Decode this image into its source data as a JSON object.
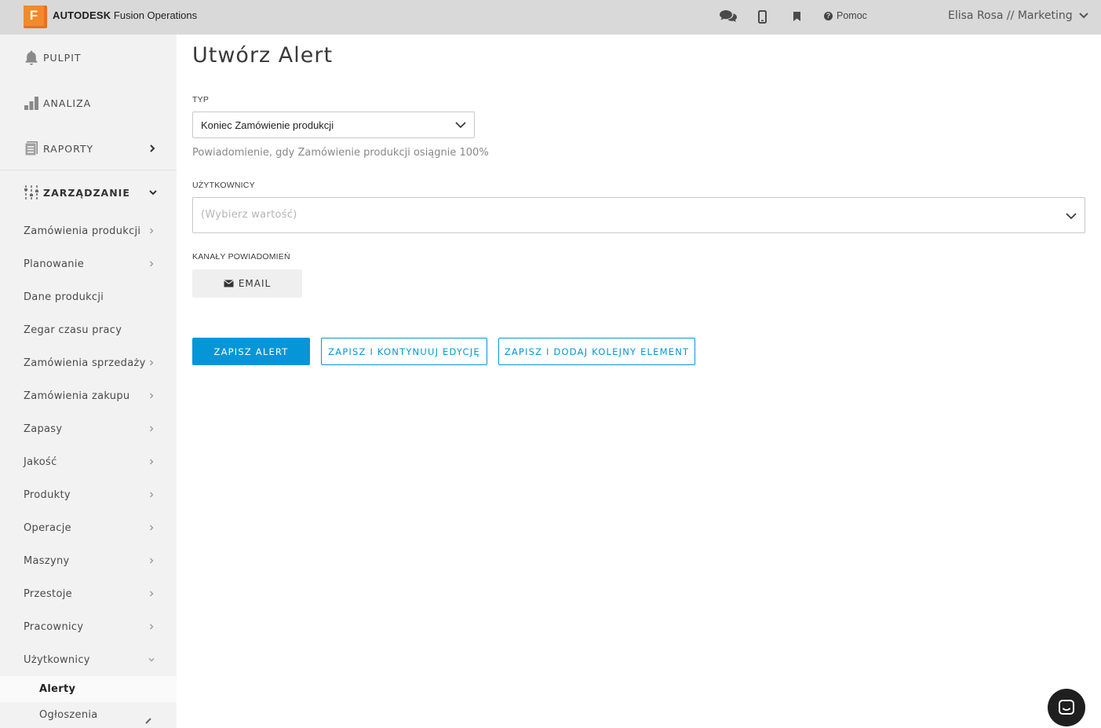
{
  "header": {
    "logo_letter": "F",
    "brand_bold": "AUTODESK",
    "brand_rest": " Fusion Operations",
    "icons": [
      "chat-icon",
      "mobile-icon",
      "bookmark-icon"
    ],
    "help_label": "Pomoc",
    "user_label": "Elisa Rosa // Marketing"
  },
  "sidebar": {
    "main": [
      {
        "label": "PULPIT",
        "icon": "bell-icon"
      },
      {
        "label": "ANALIZA",
        "icon": "bar-chart-icon"
      },
      {
        "label": "RAPORTY",
        "icon": "report-icon"
      },
      {
        "label": "ZARZĄDZANIE",
        "icon": "sliders-icon"
      }
    ],
    "items": [
      {
        "label": "Zamówienia produkcji"
      },
      {
        "label": "Planowanie"
      },
      {
        "label": "Dane produkcji"
      },
      {
        "label": "Zegar czasu pracy"
      },
      {
        "label": "Zamówienia sprzedaży"
      },
      {
        "label": "Zamówienia zakupu"
      },
      {
        "label": "Zapasy"
      },
      {
        "label": "Jakość"
      },
      {
        "label": "Produkty"
      },
      {
        "label": "Operacje"
      },
      {
        "label": "Maszyny"
      },
      {
        "label": "Przestoje"
      },
      {
        "label": "Pracownicy"
      },
      {
        "label": "Użytkownicy"
      }
    ],
    "subitems": [
      {
        "label": "Alerty",
        "active": true
      },
      {
        "label": "Ogłoszenia",
        "active": false
      }
    ]
  },
  "main": {
    "title": "Utwórz Alert",
    "type_label": "TYP",
    "type_value": "Koniec Zamówienie produkcji",
    "type_hint": "Powiadomienie, gdy Zamówienie produkcji osiągnie 100%",
    "users_label": "UŻYTKOWNICY",
    "users_placeholder": "(Wybierz wartość)",
    "channels_label": "KANAŁY POWIADOMIEŃ",
    "email_label": "EMAIL",
    "buttons": {
      "save": "ZAPISZ ALERT",
      "save_continue": "ZAPISZ I KONTYNUUJ EDYCJĘ",
      "save_add": "ZAPISZ I DODAJ KOLEJNY ELEMENT"
    }
  },
  "colors": {
    "accent": "#0696d7",
    "topbar": "#d9d9d9",
    "sidebar": "#f2f2f2",
    "logo": "#e8701e"
  }
}
